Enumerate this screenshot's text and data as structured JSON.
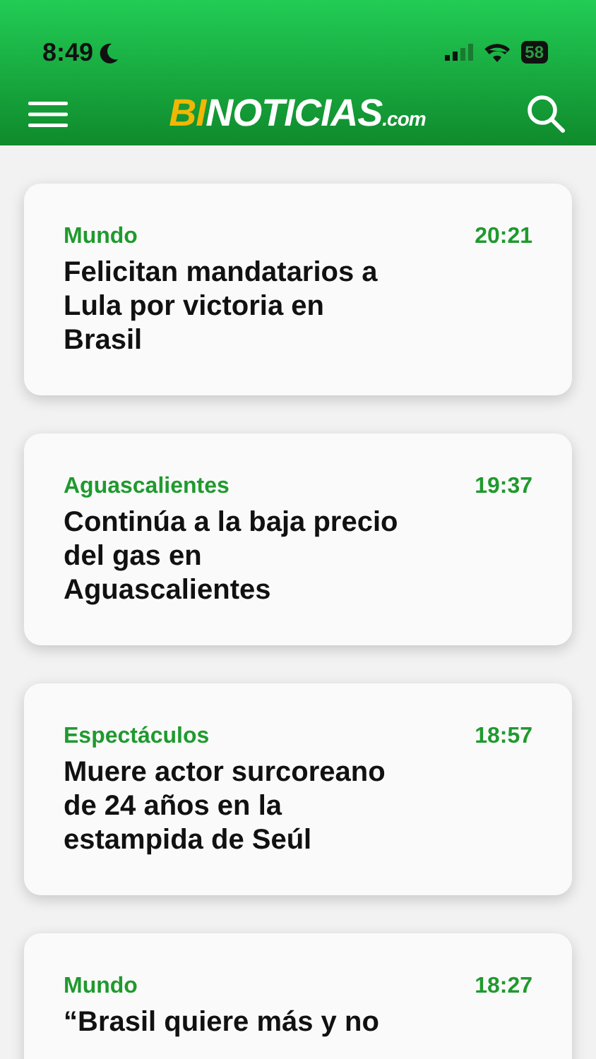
{
  "status_bar": {
    "time": "8:49",
    "battery": "58"
  },
  "header": {
    "logo": [
      "BI",
      "NOTICIAS",
      ".com"
    ]
  },
  "articles": [
    {
      "category": "Mundo",
      "time": "20:21",
      "title": "Felicitan mandatarios a Lula por victoria en Brasil"
    },
    {
      "category": "Aguascalientes",
      "time": "19:37",
      "title": "Continúa a la baja precio del gas en Aguascalientes"
    },
    {
      "category": "Espectáculos",
      "time": "18:57",
      "title": "Muere actor surcoreano de 24 años en la estampida de Seúl"
    },
    {
      "category": "Mundo",
      "time": "18:27",
      "title": "“Brasil quiere más y no"
    }
  ]
}
